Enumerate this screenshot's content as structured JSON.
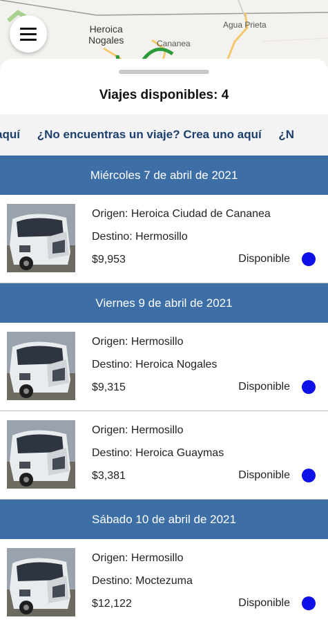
{
  "map": {
    "labels": {
      "city_1_line1": "Heroica",
      "city_1_line2": "Nogales",
      "city_2": "Cananea",
      "city_3": "Agua Prieta"
    }
  },
  "header": {
    "title": "Viajes disponibles: 4"
  },
  "banner": {
    "text": "¿No encuentras un viaje? Crea uno aquí",
    "visible_fragments": [
      "a uno aquí",
      "¿No encuentras un viaje? Crea uno aquí",
      "¿N"
    ]
  },
  "groups": [
    {
      "date": "Miércoles 7 de abril de 2021",
      "trips": [
        {
          "origin": "Origen: Heroica Ciudad de Cananea",
          "destination": "Destino: Hermosillo",
          "price": "$9,953",
          "status": "Disponible"
        }
      ]
    },
    {
      "date": "Viernes 9 de abril de 2021",
      "trips": [
        {
          "origin": "Origen: Hermosillo",
          "destination": "Destino: Heroica Nogales",
          "price": "$9,315",
          "status": "Disponible"
        },
        {
          "origin": "Origen: Hermosillo",
          "destination": "Destino: Heroica Guaymas",
          "price": "$3,381",
          "status": "Disponible"
        }
      ]
    },
    {
      "date": "Sábado 10 de abril de 2021",
      "trips": [
        {
          "origin": "Origen: Hermosillo",
          "destination": "Destino: Moctezuma",
          "price": "$12,122",
          "status": "Disponible"
        }
      ]
    }
  ],
  "colors": {
    "date_header_bg": "#3d6ea6",
    "banner_text": "#1d3f6d",
    "status_dot": "#1010e8"
  },
  "icons": {
    "menu": "hamburger-menu-icon",
    "truck": "truck-thumbnail"
  }
}
